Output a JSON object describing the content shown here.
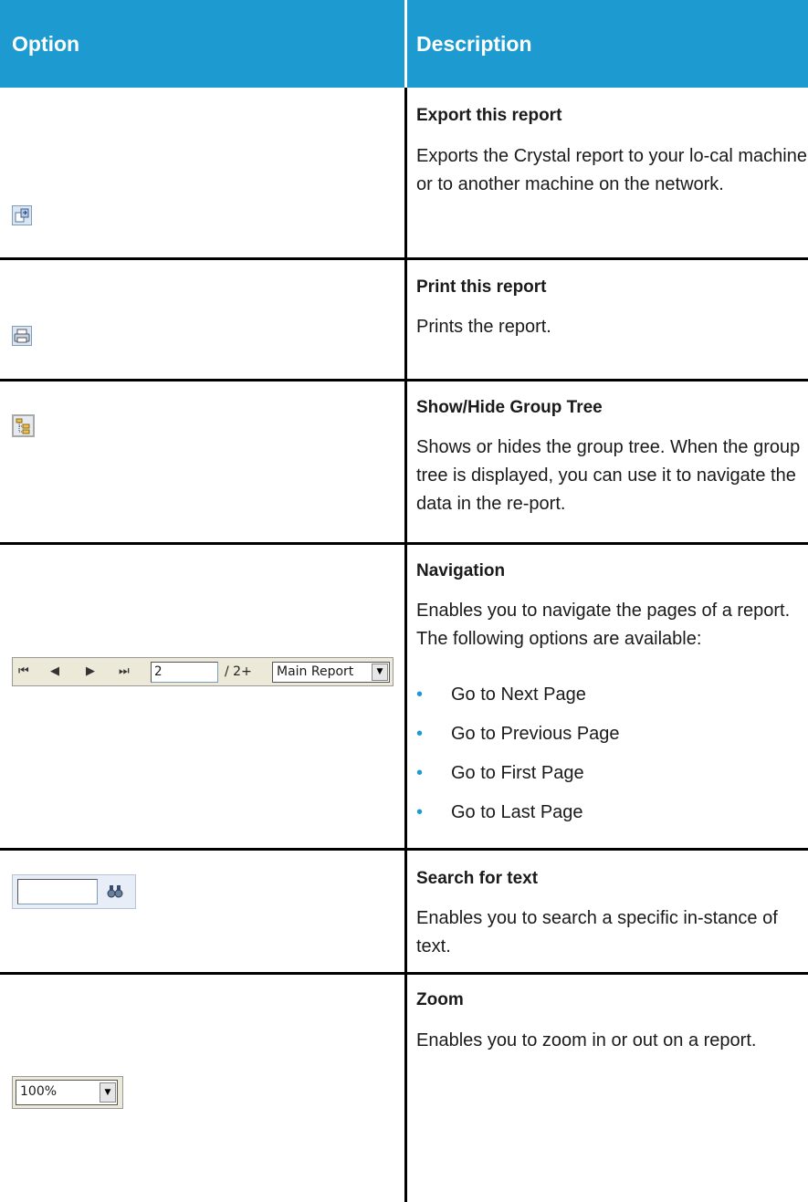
{
  "header": {
    "option_label": "Option",
    "description_label": "Description",
    "background_color": "#1d9bd0"
  },
  "rows": [
    {
      "title": "Export this report",
      "description": "Exports the Crystal report to your lo-cal machine or to another machine on the network.",
      "icon": "export-icon"
    },
    {
      "title": "Print this report",
      "description": "Prints the report.",
      "icon": "print-icon"
    },
    {
      "title": "Show/Hide Group Tree",
      "description": "Shows or hides the group tree. When the group tree is displayed, you can use it to navigate the data in the re-port.",
      "icon": "group-tree-icon"
    },
    {
      "title": "Navigation",
      "description": "Enables you to navigate the pages of a report. The following options are available:",
      "bullets": [
        "Go to Next Page",
        "Go to Previous Page",
        "Go to First Page",
        "Go to Last Page"
      ],
      "toolbar": {
        "first_icon": "⏮",
        "prev_icon": "◀",
        "next_icon": "▶",
        "last_icon": "⏭",
        "page_value": "2",
        "page_total": "/ 2+",
        "report_select_value": "Main Report",
        "dropdown_icon": "▼"
      }
    },
    {
      "title": "Search for text",
      "description": "Enables you to search a specific in-stance of text.",
      "search_icon": "🔭"
    },
    {
      "title": "Zoom",
      "description": "Enables you to zoom in or out on a report.",
      "zoom_value": "100%",
      "dropdown_icon": "▼"
    }
  ],
  "bullet_color": "#1d9bd0"
}
